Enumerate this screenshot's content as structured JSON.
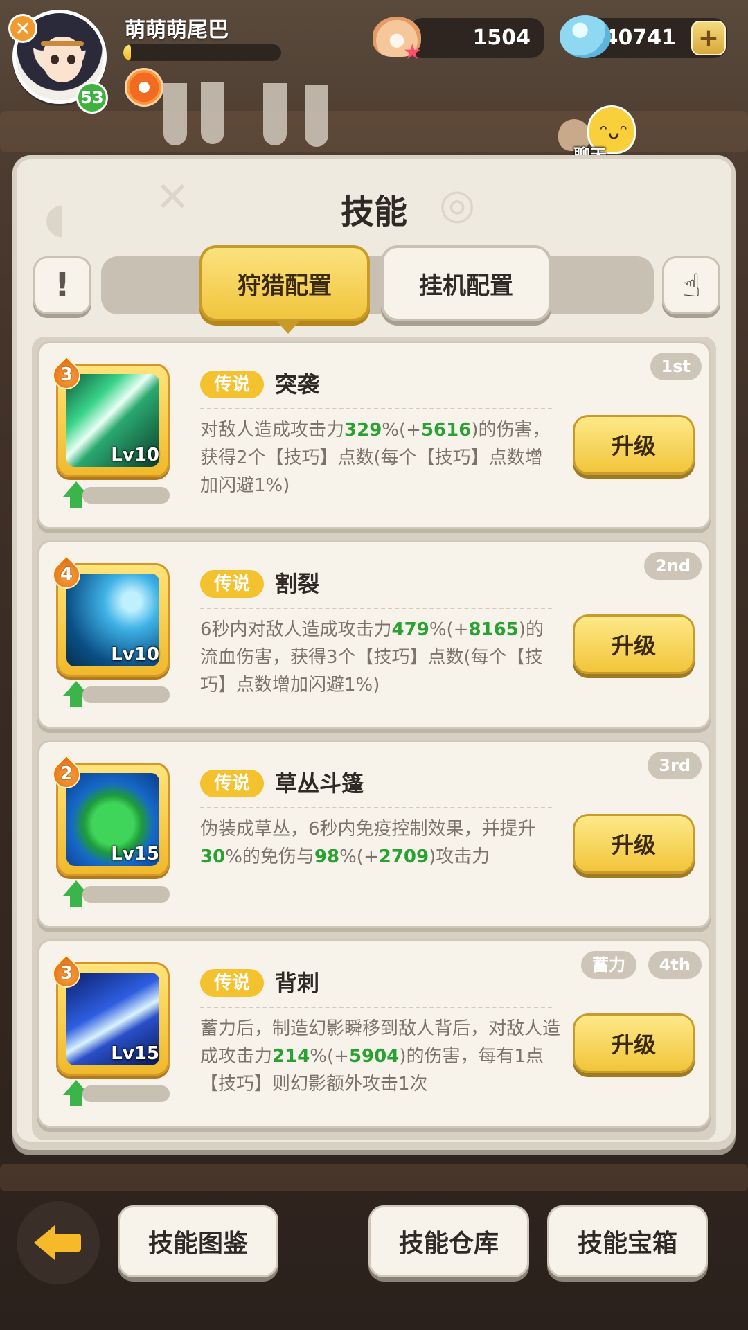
{
  "player": {
    "name": "萌萌萌尾巴",
    "level": "53",
    "xp_progress": 0.05
  },
  "currencies": {
    "pearl": {
      "icon": "pearl-shell-icon",
      "value": "1504"
    },
    "gem": {
      "icon": "gem-shell-icon",
      "value": "40741"
    }
  },
  "chat": {
    "label": "聊天"
  },
  "panel": {
    "title": "技能",
    "info_symbol": "!",
    "tabs": [
      {
        "label": "狩猎配置",
        "active": true
      },
      {
        "label": "挂机配置",
        "active": false
      }
    ]
  },
  "skills": [
    {
      "stars": "3",
      "level": "Lv10",
      "quality": "传说",
      "name": "突袭",
      "rank": "1st",
      "tag": "",
      "desc_parts": [
        {
          "t": "对敌人造成攻击力",
          "g": false
        },
        {
          "t": "329",
          "g": true
        },
        {
          "t": "%(+",
          "g": false
        },
        {
          "t": "5616",
          "g": true
        },
        {
          "t": ")的伤害，获得2个【技巧】点数(每个【技巧】点数增加闪避1%)",
          "g": false
        }
      ],
      "upgrade_label": "升级"
    },
    {
      "stars": "4",
      "level": "Lv10",
      "quality": "传说",
      "name": "割裂",
      "rank": "2nd",
      "tag": "",
      "desc_parts": [
        {
          "t": "6秒内对敌人造成攻击力",
          "g": false
        },
        {
          "t": "479",
          "g": true
        },
        {
          "t": "%(+",
          "g": false
        },
        {
          "t": "8165",
          "g": true
        },
        {
          "t": ")的流血伤害，获得3个【技巧】点数(每个【技巧】点数增加闪避1%)",
          "g": false
        }
      ],
      "upgrade_label": "升级"
    },
    {
      "stars": "2",
      "level": "Lv15",
      "quality": "传说",
      "name": "草丛斗篷",
      "rank": "3rd",
      "tag": "",
      "desc_parts": [
        {
          "t": "伪装成草丛，6秒内免疫控制效果，并提升",
          "g": false
        },
        {
          "t": "30",
          "g": true
        },
        {
          "t": "%的免伤与",
          "g": false
        },
        {
          "t": "98",
          "g": true
        },
        {
          "t": "%(+",
          "g": false
        },
        {
          "t": "2709",
          "g": true
        },
        {
          "t": ")攻击力",
          "g": false
        }
      ],
      "upgrade_label": "升级"
    },
    {
      "stars": "3",
      "level": "Lv15",
      "quality": "传说",
      "name": "背刺",
      "rank": "4th",
      "tag": "蓄力",
      "desc_parts": [
        {
          "t": "蓄力后，制造幻影瞬移到敌人背后，对敌人造成攻击力",
          "g": false
        },
        {
          "t": "214",
          "g": true
        },
        {
          "t": "%(+",
          "g": false
        },
        {
          "t": "5904",
          "g": true
        },
        {
          "t": ")的伤害，每有1点【技巧】则幻影额外攻击1次",
          "g": false
        }
      ],
      "upgrade_label": "升级"
    }
  ],
  "bottom": {
    "codex_label": "技能图鉴",
    "storage_label": "技能仓库",
    "chest_label": "技能宝箱"
  },
  "colors": {
    "accent_yellow": "#f2c53a",
    "highlight_green": "#2aa133",
    "panel_bg": "#efeae0"
  }
}
